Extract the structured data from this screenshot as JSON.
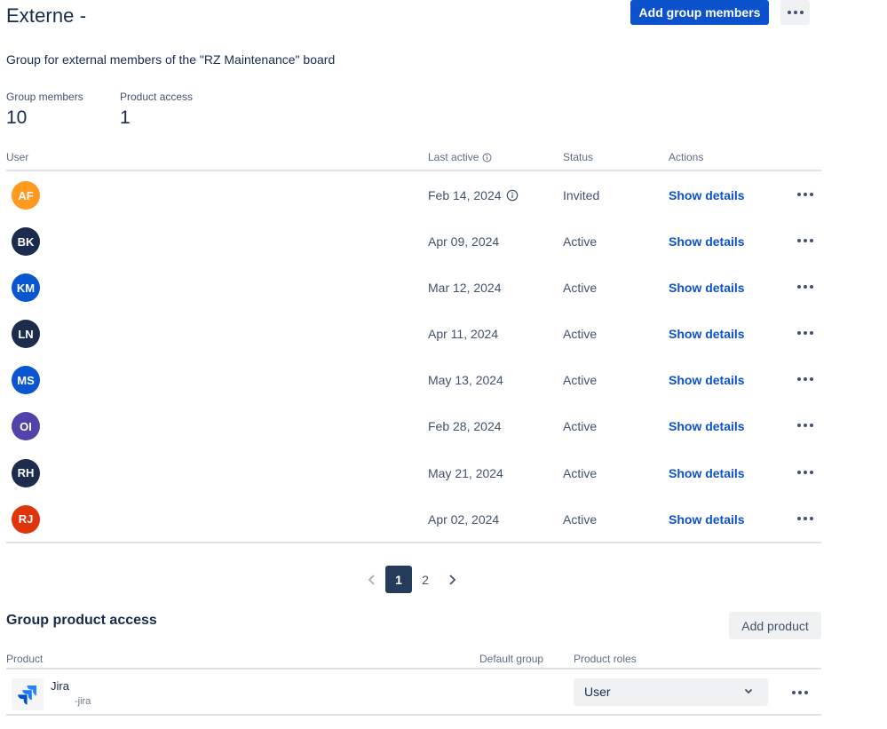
{
  "group": {
    "title": "Externe -",
    "description": "Group for external members of the \"RZ Maintenance\" board",
    "add_members_label": "Add group members"
  },
  "stats": {
    "members_label": "Group members",
    "members_value": "10",
    "access_label": "Product access",
    "access_value": "1"
  },
  "members_table": {
    "columns": {
      "user": "User",
      "last_active": "Last active",
      "status": "Status",
      "actions": "Actions"
    },
    "rows": [
      {
        "initials": "AF",
        "avatar_color": "#ff991f",
        "last_active": "Feb 14, 2024",
        "info": true,
        "status": "Invited",
        "action": "Show details"
      },
      {
        "initials": "BK",
        "avatar_color": "#1d2c4d",
        "last_active": "Apr 09, 2024",
        "info": false,
        "status": "Active",
        "action": "Show details"
      },
      {
        "initials": "KM",
        "avatar_color": "#0a56d0",
        "last_active": "Mar 12, 2024",
        "info": false,
        "status": "Active",
        "action": "Show details"
      },
      {
        "initials": "LN",
        "avatar_color": "#1d2c4d",
        "last_active": "Apr 11, 2024",
        "info": false,
        "status": "Active",
        "action": "Show details"
      },
      {
        "initials": "MS",
        "avatar_color": "#0a56d0",
        "last_active": "May 13, 2024",
        "info": false,
        "status": "Active",
        "action": "Show details"
      },
      {
        "initials": "OI",
        "avatar_color": "#5243aa",
        "last_active": "Feb 28, 2024",
        "info": false,
        "status": "Active",
        "action": "Show details"
      },
      {
        "initials": "RH",
        "avatar_color": "#1d2c4d",
        "last_active": "May 21, 2024",
        "info": false,
        "status": "Active",
        "action": "Show details"
      },
      {
        "initials": "RJ",
        "avatar_color": "#de350b",
        "last_active": "Apr 02, 2024",
        "info": false,
        "status": "Active",
        "action": "Show details"
      }
    ]
  },
  "pagination": {
    "prev_icon": "chevron-left-icon",
    "pages": [
      "1",
      "2"
    ],
    "current": "1",
    "next_icon": "chevron-right-icon"
  },
  "product_access": {
    "title": "Group product access",
    "add_label": "Add product",
    "columns": {
      "product": "Product",
      "default_group": "Default group",
      "roles": "Product roles"
    },
    "rows": [
      {
        "name": "Jira",
        "sub": "-jira",
        "role": "User",
        "icon": "jira-logo-icon"
      }
    ]
  },
  "colors": {
    "primary": "#0c52cc",
    "pager_active": "#243c5a"
  }
}
